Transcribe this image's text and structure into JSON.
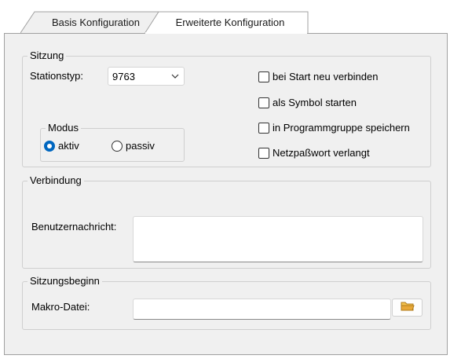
{
  "tabs": [
    {
      "label": "Basis Konfiguration",
      "active": false
    },
    {
      "label": "Erweiterte Konfiguration",
      "active": true
    }
  ],
  "sitzung": {
    "legend": "Sitzung",
    "stationstyp_label": "Stationstyp:",
    "stationstyp_value": "9763",
    "modus": {
      "legend": "Modus",
      "options": [
        {
          "label": "aktiv",
          "selected": true
        },
        {
          "label": "passiv",
          "selected": false
        }
      ]
    },
    "checkboxes": [
      {
        "label": "bei Start neu verbinden",
        "checked": false
      },
      {
        "label": "als Symbol starten",
        "checked": false
      },
      {
        "label": "in Programmgruppe speichern",
        "checked": false
      },
      {
        "label": "Netzpaßwort verlangt",
        "checked": false
      }
    ]
  },
  "verbindung": {
    "legend": "Verbindung",
    "benutzernachricht_label": "Benutzernachricht:",
    "benutzernachricht_value": ""
  },
  "sitzungsbeginn": {
    "legend": "Sitzungsbeginn",
    "makro_label": "Makro-Datei:",
    "makro_value": ""
  },
  "colors": {
    "accent": "#0067c0",
    "panel_bg": "#f0f0f0",
    "folder_icon": "#e8a838"
  },
  "icons": [
    "chevron-down-icon",
    "folder-icon"
  ]
}
